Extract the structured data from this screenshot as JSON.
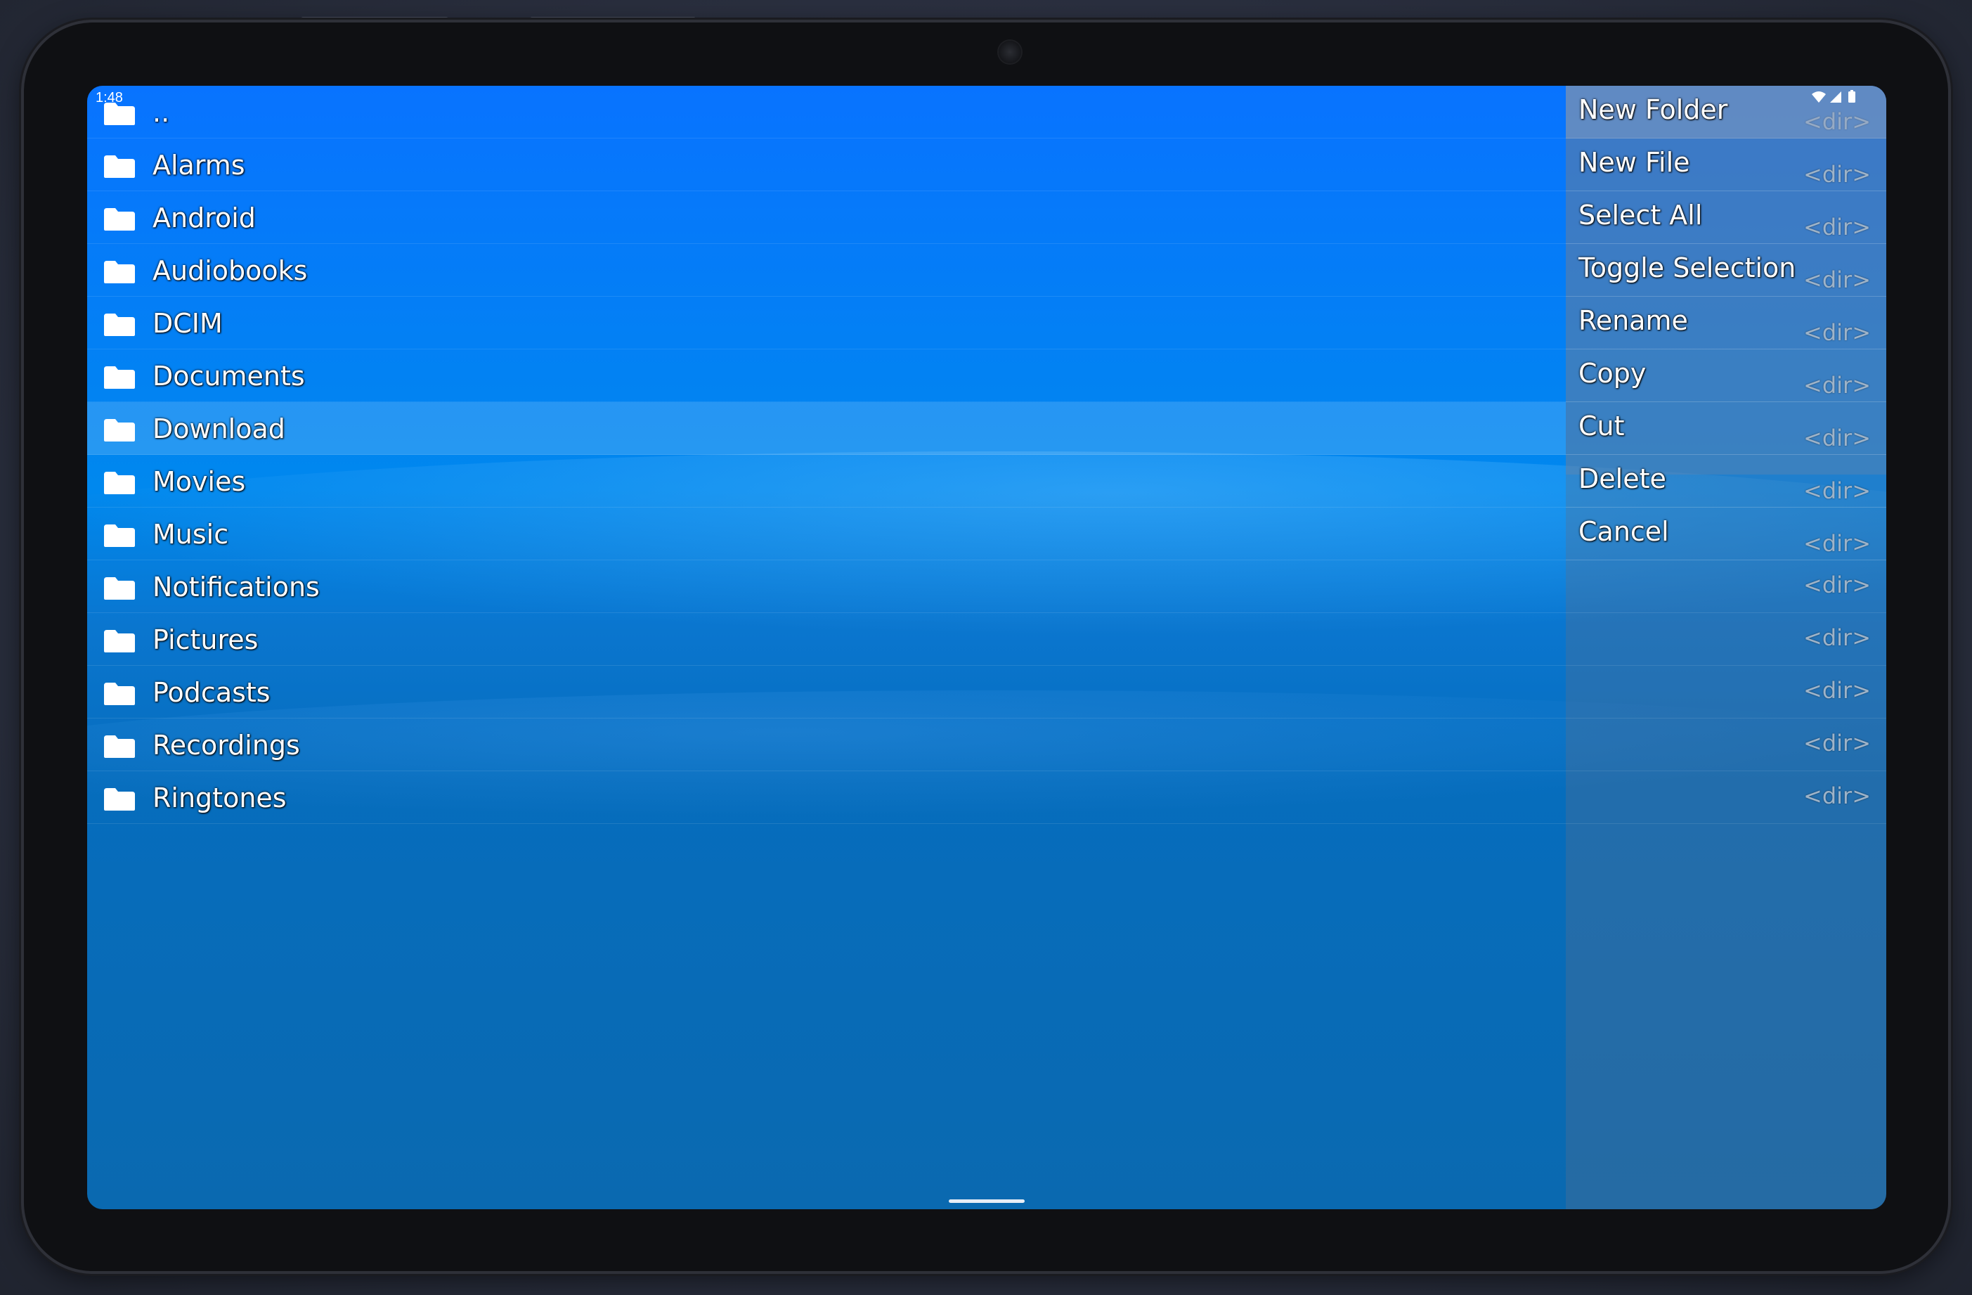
{
  "status_bar": {
    "time": "1:48"
  },
  "files": [
    {
      "name": "..",
      "type": "<dir>"
    },
    {
      "name": "Alarms",
      "type": "<dir>"
    },
    {
      "name": "Android",
      "type": "<dir>"
    },
    {
      "name": "Audiobooks",
      "type": "<dir>"
    },
    {
      "name": "DCIM",
      "type": "<dir>"
    },
    {
      "name": "Documents",
      "type": "<dir>"
    },
    {
      "name": "Download",
      "type": "<dir>",
      "selected": true
    },
    {
      "name": "Movies",
      "type": "<dir>"
    },
    {
      "name": "Music",
      "type": "<dir>"
    },
    {
      "name": "Notifications",
      "type": "<dir>"
    },
    {
      "name": "Pictures",
      "type": "<dir>"
    },
    {
      "name": "Podcasts",
      "type": "<dir>"
    },
    {
      "name": "Recordings",
      "type": "<dir>"
    },
    {
      "name": "Ringtones",
      "type": "<dir>"
    }
  ],
  "context_menu": [
    {
      "label": "New Folder"
    },
    {
      "label": "New File"
    },
    {
      "label": "Select All"
    },
    {
      "label": "Toggle Selection"
    },
    {
      "label": "Rename"
    },
    {
      "label": "Copy"
    },
    {
      "label": "Cut"
    },
    {
      "label": "Delete"
    },
    {
      "label": "Cancel"
    }
  ],
  "icons": {
    "folder": "folder-icon",
    "wifi": "wifi-icon",
    "signal": "signal-icon",
    "battery": "battery-icon"
  },
  "colors": {
    "screen_top": "#0873ff",
    "screen_bottom": "#0a69b0",
    "text": "#ffffff",
    "dir_tag": "#9eb3c8"
  }
}
